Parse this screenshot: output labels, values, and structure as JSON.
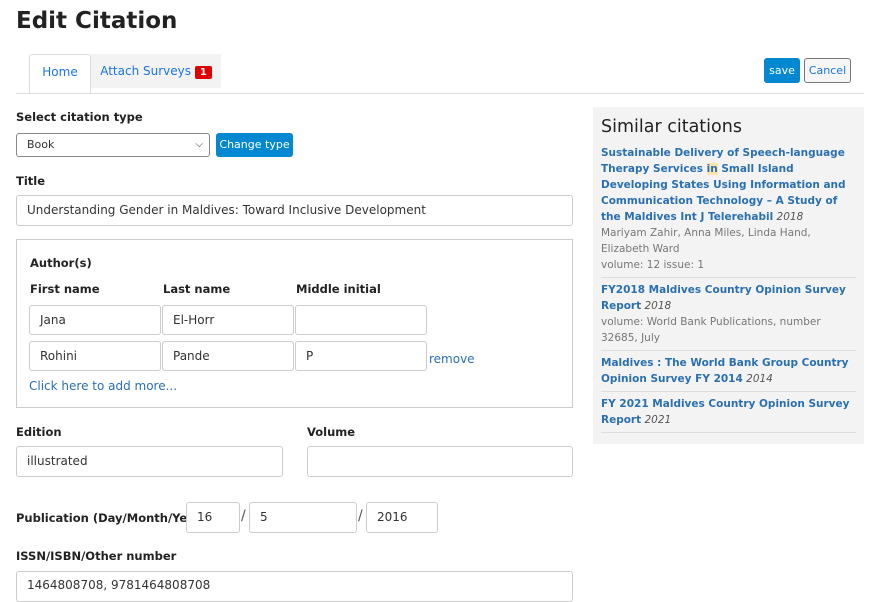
{
  "page": {
    "title": "Edit Citation"
  },
  "tabs": [
    {
      "label": "Home",
      "active": true
    },
    {
      "label": "Attach Surveys",
      "badge": "1"
    }
  ],
  "toolbar": {
    "save_label": "save",
    "cancel_label": "Cancel"
  },
  "citation_type": {
    "label": "Select citation type",
    "value": "Book",
    "change_label": "Change type"
  },
  "title_field": {
    "label": "Title",
    "value": "Understanding Gender in Maldives: Toward Inclusive Development"
  },
  "authors": {
    "label": "Author(s)",
    "headers": [
      "First name",
      "Last name",
      "Middle initial"
    ],
    "rows": [
      {
        "first": "Jana",
        "last": "El-Horr",
        "middle": ""
      },
      {
        "first": "Rohini",
        "last": "Pande",
        "middle": "P",
        "remove": "remove"
      }
    ],
    "add_more": "Click here to add more..."
  },
  "edition": {
    "label": "Edition",
    "value": "illustrated"
  },
  "volume": {
    "label": "Volume",
    "value": ""
  },
  "publication": {
    "label": "Publication (Day/Month/Year)",
    "day": "16",
    "month": "5",
    "year": "2016",
    "sep": "/"
  },
  "issn": {
    "label": "ISSN/ISBN/Other number",
    "value": "1464808708, 9781464808708"
  },
  "similar": {
    "title": "Similar citations",
    "items": [
      {
        "title_pre": "Sustainable Delivery of Speech-language Therapy Services ",
        "title_hl": "in",
        "title_post": " Small Island Developing States Using Information and Communication Technology – A Study of the Maldives Int J Telerehabil",
        "year": "2018",
        "authors": "Mariyam Zahir, Anna Miles, Linda Hand, Elizabeth Ward",
        "meta": "volume: 12 issue: 1"
      },
      {
        "title_pre": "FY2018 Maldives Country Opinion Survey Report",
        "year": "2018",
        "meta": "volume: World Bank Publications, number 32685, July"
      },
      {
        "title_pre": "Maldives : The World Bank Group Country Opinion Survey FY 2014",
        "year": "2014"
      },
      {
        "title_pre": "FY 2021 Maldives Country Opinion Survey Report",
        "year": "2021"
      }
    ]
  },
  "colors": {
    "primary": "#0288d1",
    "link": "#2a6fb0",
    "badge": "#e00000",
    "sidebar_bg": "#f3f3f3"
  }
}
